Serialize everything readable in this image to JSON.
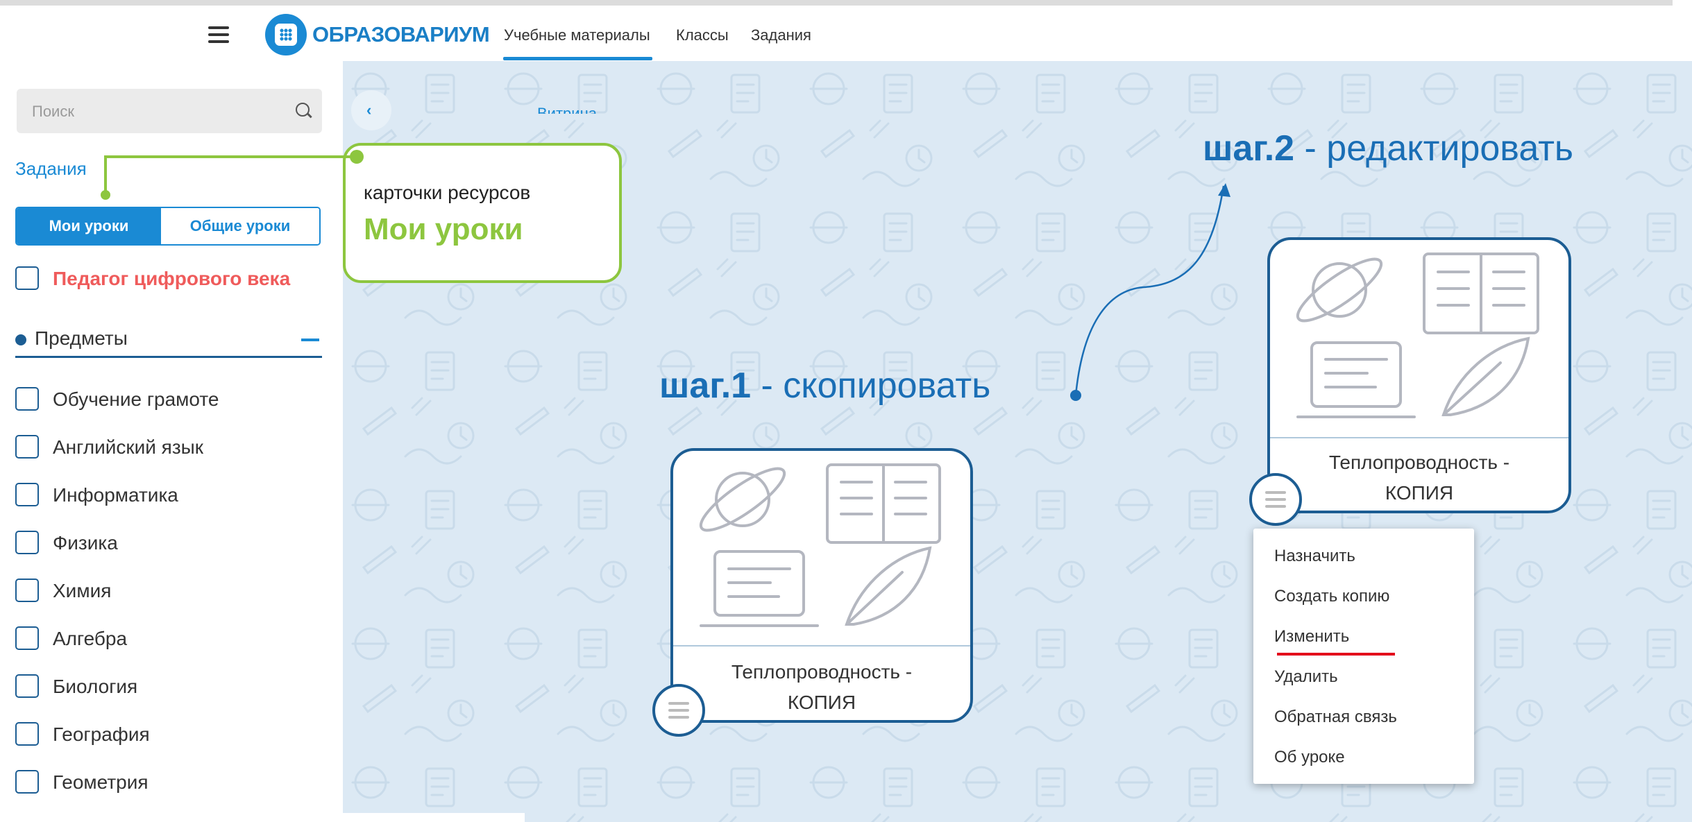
{
  "header": {
    "logo_text": "ОБРАЗОВАРИУМ",
    "nav": [
      {
        "label": "Учебные материалы",
        "active": true
      },
      {
        "label": "Классы",
        "active": false
      },
      {
        "label": "Задания",
        "active": false
      }
    ]
  },
  "sidebar": {
    "search": {
      "placeholder": "Поиск"
    },
    "link_tasks": "Задания",
    "tabs": [
      {
        "label": "Мои уроки",
        "active": true
      },
      {
        "label": "Общие уроки",
        "active": false
      }
    ],
    "special_filter": {
      "label": "Педагог цифрового века",
      "checked": false
    },
    "subjects_section": {
      "title": "Предметы"
    },
    "subjects": [
      {
        "label": "Обучение грамоте",
        "checked": false
      },
      {
        "label": "Английский язык",
        "checked": false
      },
      {
        "label": "Информатика",
        "checked": false
      },
      {
        "label": "Физика",
        "checked": false
      },
      {
        "label": "Химия",
        "checked": false
      },
      {
        "label": "Алгебра",
        "checked": false
      },
      {
        "label": "Биология",
        "checked": false
      },
      {
        "label": "География",
        "checked": false
      },
      {
        "label": "Геометрия",
        "checked": false
      }
    ]
  },
  "main": {
    "breadcrumb": "Витрина"
  },
  "callout": {
    "line1": "карточки ресурсов",
    "line2": "Мои уроки"
  },
  "steps": {
    "step1": {
      "bold": "шаг.1",
      "text": " - скопировать"
    },
    "step2": {
      "bold": "шаг.2",
      "text": " - редактировать"
    }
  },
  "cards": [
    {
      "title_line1": "Теплопроводность -",
      "title_line2": "КОПИЯ"
    },
    {
      "title_line1": "Теплопроводность -",
      "title_line2": "КОПИЯ"
    }
  ],
  "context_menu": {
    "items": [
      "Назначить",
      "Создать копию",
      "Изменить",
      "Удалить",
      "Обратная связь",
      "Об уроке"
    ],
    "highlighted": "Изменить"
  },
  "colors": {
    "brand_blue": "#1a8ad4",
    "dark_blue": "#1c5d93",
    "callout_green": "#8dc63f",
    "accent_red": "#e3001b",
    "filter_red": "#ef5b5b",
    "main_bg": "#dce9f4"
  },
  "icons": {
    "menu": "hamburger-icon",
    "logo": "app-grid-icon",
    "search": "search-icon",
    "collapse": "chevron-left-icon",
    "card_image": [
      "planet-icon",
      "book-icon",
      "laptop-icon",
      "feather-icon"
    ],
    "card_menu": "hamburger-icon"
  }
}
